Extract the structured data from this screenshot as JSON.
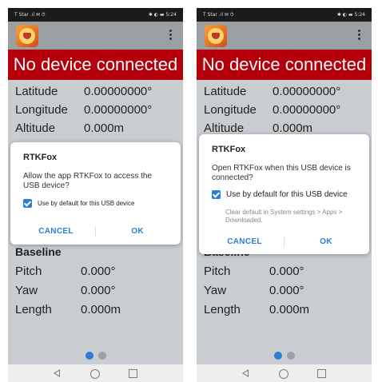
{
  "status": {
    "left_text": "T Star .ıl ✉ ⏱",
    "right_text": "✱ ◐ ▬ 5:24"
  },
  "banner": {
    "text": "No device connected"
  },
  "position": {
    "latitude_label": "Latitude",
    "latitude_value": "0.00000000°",
    "longitude_label": "Longitude",
    "longitude_value": "0.00000000°",
    "altitude_label": "Altitude",
    "altitude_value": "0.000m"
  },
  "baseline": {
    "title": "Baseline",
    "pitch_label": "Pitch",
    "pitch_value": "0.000°",
    "yaw_label": "Yaw",
    "yaw_value": "0.000°",
    "length_label": "Length",
    "length_value": "0.000m"
  },
  "dialog_left": {
    "title": "RTKFox",
    "message_line1": "Allow the app RTKFox to access the",
    "message_line2": "USB device?",
    "checkbox_label": "Use by default for this USB device",
    "cancel_label": "CANCEL",
    "ok_label": "OK"
  },
  "dialog_right": {
    "title": "RTKFox",
    "message_line1": "Open RTKFox when this USB device is",
    "message_line2": "connected?",
    "checkbox_label": "Use by default for this USB device",
    "hint_line1": "Clear default in System settings > Apps >",
    "hint_line2": "Downloaded.",
    "cancel_label": "CANCEL",
    "ok_label": "OK"
  },
  "page_indicator": {
    "active": 1,
    "total": 2
  },
  "colors": {
    "banner": "#b5000c",
    "accent": "#2a7fd4",
    "background": "#c9cdd1"
  },
  "icons": [
    "rtkfox-app-icon",
    "overflow-menu-icon",
    "back-icon",
    "home-icon",
    "recents-icon",
    "checkbox-checked-icon"
  ]
}
